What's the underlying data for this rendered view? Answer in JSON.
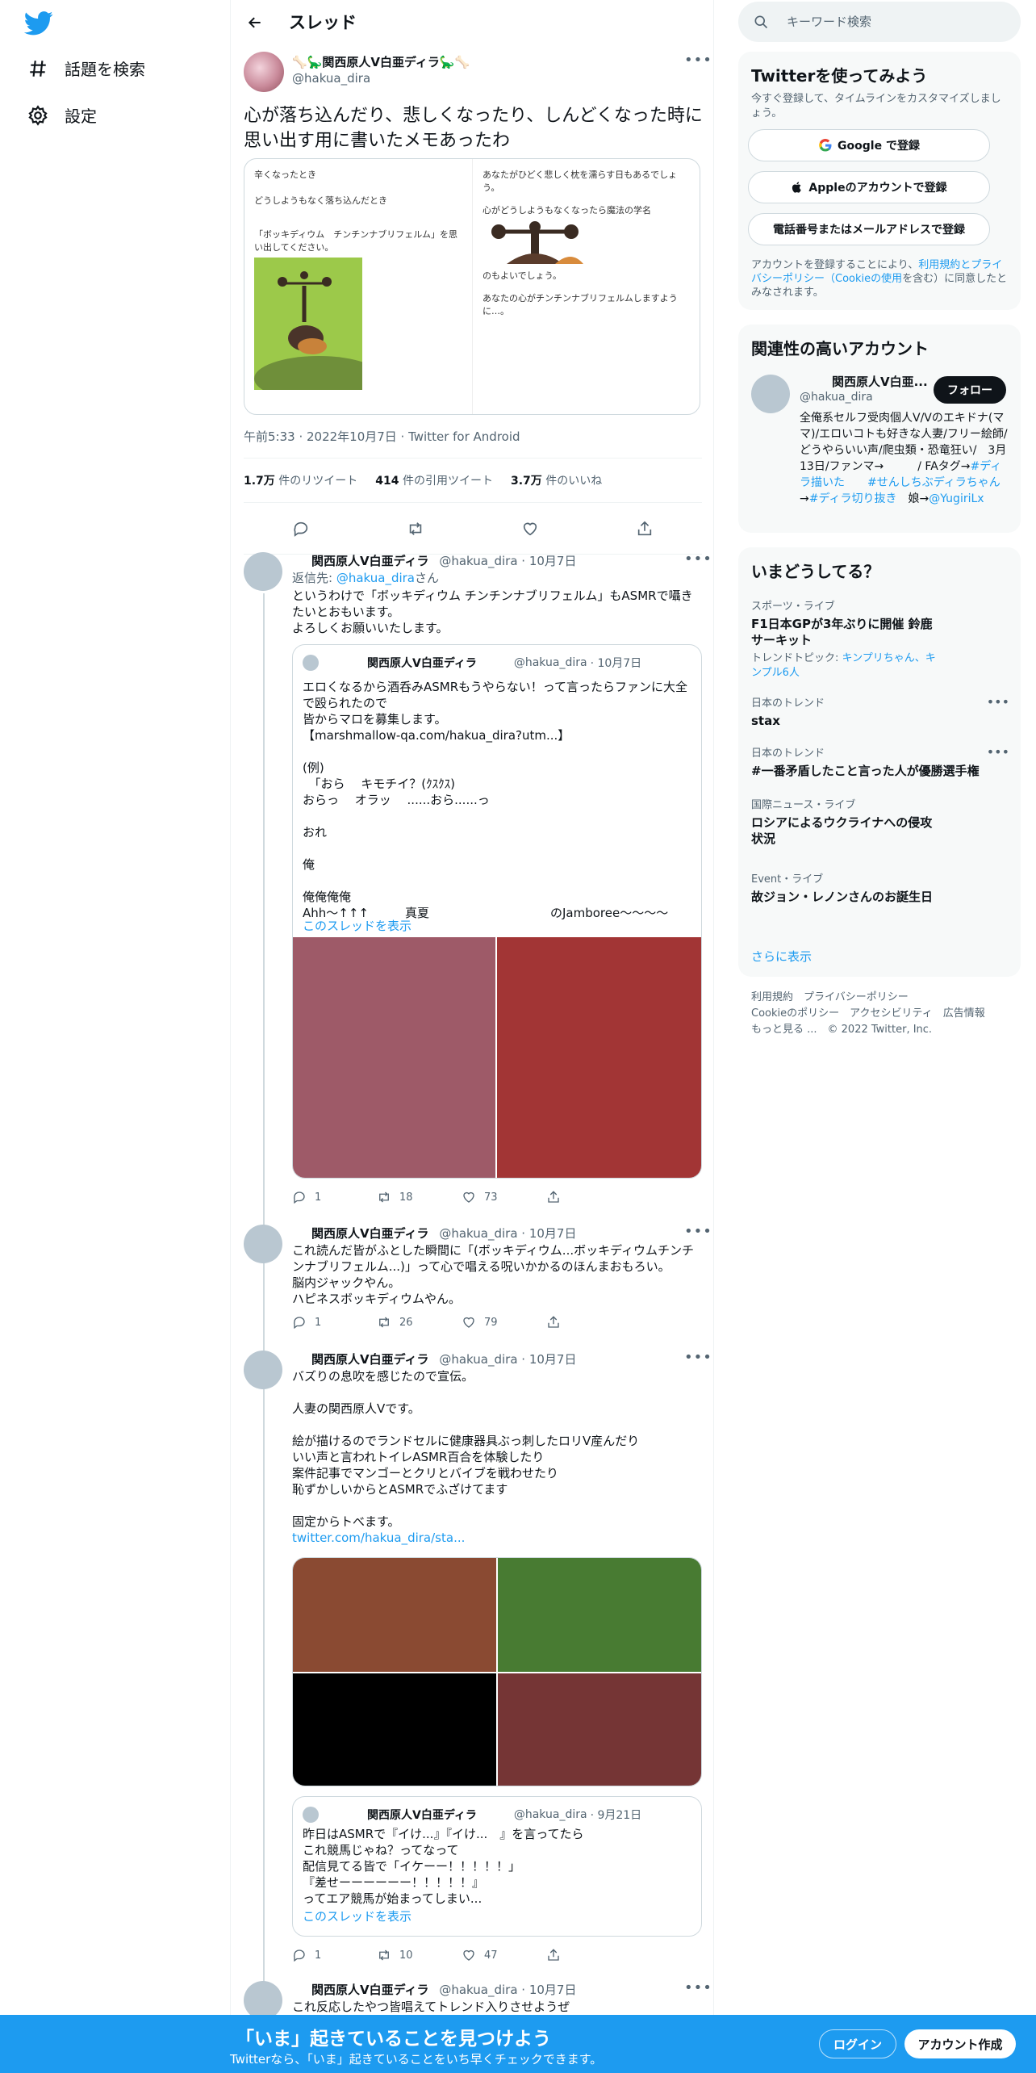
{
  "nav": {
    "explore_label": "話題を検索",
    "settings_label": "設定"
  },
  "header": {
    "title": "スレッド"
  },
  "focal": {
    "name": "🦴🦕関西原人V白亜ディラ🦕🦴",
    "handle": "@hakua_dira",
    "text": "心が落ち込んだり、悲しくなったり、しんどくなった時に思い出す用に書いたメモあったわ",
    "memo_left": [
      "辛くなったとき",
      "どうしようもなく落ち込んだとき",
      "「ボッキディウム　チンチンナブリフェルム」を思い出してください。"
    ],
    "memo_right_top": [
      "あなたがひどく悲しく枕を濡らす日もあるでしょう。",
      "心がどうしようもなくなったら魔法の学名"
    ],
    "memo_right_bottom": [
      "のもよいでしょう。",
      "あなたの心がチンチンナブリフェルムしますように…。"
    ],
    "timestamp": "午前5:33 · 2022年10月7日 · Twitter for Android",
    "stats": {
      "retweets": "1.7万",
      "retweets_label": "件のリツイート",
      "quotes": "414",
      "quotes_label": "件の引用ツイート",
      "likes": "3.7万",
      "likes_label": "件のいいね"
    }
  },
  "replies": [
    {
      "name": "関西原人V白亜ディラ",
      "handle": "@hakua_dira",
      "date": "· 10月7日",
      "reply_to_prefix": "返信先: ",
      "reply_to_handle": "@hakua_dira",
      "reply_to_suffix": "さん",
      "text": "というわけで「ボッキディウム チンチンナブリフェルム」もASMRで囁きたいとおもいます。\nよろしくお願いいたします。",
      "quote": {
        "name": "関西原人V白亜ディラ",
        "handle": "@hakua_dira",
        "date": "· 10月7日",
        "text": "エロくなるから酒呑みASMRもうやらない！って言ったらファンに大全で殴られたので\n皆からマロを募集します。\n【marshmallow-qa.com/hakua_dira?utm...】\n\n(例)\n　「おら　 キモチイ？(ｸｽｸｽ)\nおらっ　 オラッ　 ......おら......っ\n\nおれ\n\n俺\n\n俺俺俺俺\nAhh～↑↑↑　　　真夏　　　　　　　　　　のJamboree〜〜〜〜",
        "show_thread": "このスレッドを表示"
      },
      "stats": {
        "reply": "1",
        "retweet": "18",
        "like": "73"
      }
    },
    {
      "name": "関西原人V白亜ディラ",
      "handle": "@hakua_dira",
      "date": "· 10月7日",
      "text": "これ読んだ皆がふとした瞬間に「(ボッキディウム...ボッキディウムチンチンナブリフェルム...)」って心で唱える呪いかかるのほんまおもろい。\n脳内ジャックやん。\nハピネスボッキディウムやん。",
      "stats": {
        "reply": "1",
        "retweet": "26",
        "like": "79"
      }
    },
    {
      "name": "関西原人V白亜ディラ",
      "handle": "@hakua_dira",
      "date": "· 10月7日",
      "text": "バズりの息吹を感じたので宣伝。\n\n人妻の関西原人Vです。\n\n絵が描けるのでランドセルに健康器具ぶっ刺したロリV産んだり\nいい声と言われトイレASMR百合を体験したり\n案件記事でマンゴーとクリとバイブを戦わせたり\n恥ずかしいからとASMRでふざけてます\n\n固定からトべます。",
      "link": "twitter.com/hakua_dira/sta...",
      "quote": {
        "name": "関西原人V白亜ディラ",
        "handle": "@hakua_dira",
        "date": "· 9月21日",
        "text": "昨日はASMRで『イけ...』『イけ...　』を言ってたら\nこれ競馬じゃね？ってなって\n配信見てる皆で「イケーー！！！！！」\n『差せーーーーーー！！！！！』\nってエア競馬が始まってしまい...",
        "show_thread": "このスレッドを表示"
      },
      "stats": {
        "reply": "1",
        "retweet": "10",
        "like": "47"
      }
    },
    {
      "name": "関西原人V白亜ディラ",
      "handle": "@hakua_dira",
      "date": "· 10月7日",
      "text": "これ反応したやつ皆唱えてトレンド入りさせようぜ"
    }
  ],
  "right": {
    "search_placeholder": "キーワード検索",
    "signup": {
      "title": "Twitterを使ってみよう",
      "subtitle": "今すぐ登録して、タイムラインをカスタマイズしましょう。",
      "google_btn": "Google で登録",
      "apple_btn": "Appleのアカウントで登録",
      "phone_btn": "電話番号またはメールアドレスで登録",
      "terms_prefix": "アカウントを登録することにより、",
      "terms_link": "利用規約とプライバシーポリシー（Cookieの使用",
      "terms_suffix": "を含む）に同意したとみなされます。"
    },
    "relevant": {
      "title": "関連性の高いアカウント",
      "name": "関西原人V白亜...",
      "handle": "@hakua_dira",
      "follow": "フォロー",
      "bio": "全俺系セルフ受肉個人V/Vのエキドナ(ママ)/エロいコトも好きな人妻/フリー絵師/どうやらいい声/爬虫類・恐竜狂い/　3月13日/ファンマ→　　　/ FAタグ→",
      "tag1": "#ディラ描いた",
      "tag2": "#せんしちぶディラちゃん",
      "tag_prefix": "→",
      "tag3": "#ディラ切り抜き",
      "daughter": "　娘→",
      "daughter_link": "@YugiriLx"
    },
    "trends": {
      "title": "いまどうしてる？",
      "items": [
        {
          "category": "スポーツ・ライブ",
          "title": "F1日本GPが3年ぶりに開催 鈴鹿サーキット",
          "topic_prefix": "トレンドトピック: ",
          "topic": "キンプリちゃん、キンプル6人"
        },
        {
          "category": "日本のトレンド",
          "title": "stax"
        },
        {
          "category": "日本のトレンド",
          "title": "#一番矛盾したこと言った人が優勝選手権"
        },
        {
          "category": "国際ニュース・ライブ",
          "title": "ロシアによるウクライナへの侵攻状況"
        },
        {
          "category": "Event・ライブ",
          "title": "故ジョン・レノンさんのお誕生日"
        }
      ],
      "more": "さらに表示"
    },
    "footer": {
      "l1": "利用規約　プライバシーポリシー",
      "l2": "Cookieのポリシー　アクセシビリティ　広告情報",
      "l3": "もっと見る ...　© 2022 Twitter, Inc."
    }
  },
  "bottom_bar": {
    "title": "「いま」起きていることを見つけよう",
    "subtitle": "Twitterなら、「いま」起きていることをいち早くチェックできます。",
    "login": "ログイン",
    "signup": "アカウント作成"
  },
  "colors": {
    "accent": "#1d9bf0",
    "text": "#0f1419",
    "muted": "#536471"
  }
}
